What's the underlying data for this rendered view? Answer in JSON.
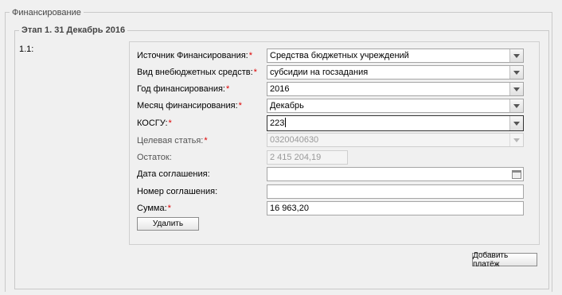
{
  "section": {
    "title": "Финансирование"
  },
  "stage": {
    "title": "Этап 1. 31 Декабрь 2016",
    "item_number": "1.1:"
  },
  "form": {
    "source": {
      "label": "Источник Финансирования:",
      "value": "Средства бюджетных учреждений",
      "required": "*"
    },
    "offbudget": {
      "label": "Вид внебюджетных средств:",
      "value": "субсидии на госзадания",
      "required": "*"
    },
    "year": {
      "label": "Год финансирования:",
      "value": "2016",
      "required": "*"
    },
    "month": {
      "label": "Месяц финансирования:",
      "value": "Декабрь",
      "required": "*"
    },
    "kosgu": {
      "label": "КОСГУ:",
      "value": "223",
      "required": "*"
    },
    "target": {
      "label": "Целевая статья:",
      "value": "0320040630",
      "required": "*"
    },
    "balance": {
      "label": "Остаток:",
      "value": "2 415 204,19"
    },
    "agreement_date": {
      "label": "Дата соглашения:",
      "value": ""
    },
    "agreement_number": {
      "label": "Номер соглашения:",
      "value": ""
    },
    "amount": {
      "label": "Сумма:",
      "value": "16 963,20",
      "required": "*"
    },
    "delete_label": "Удалить"
  },
  "add_payment_label": "Добавить платёж"
}
